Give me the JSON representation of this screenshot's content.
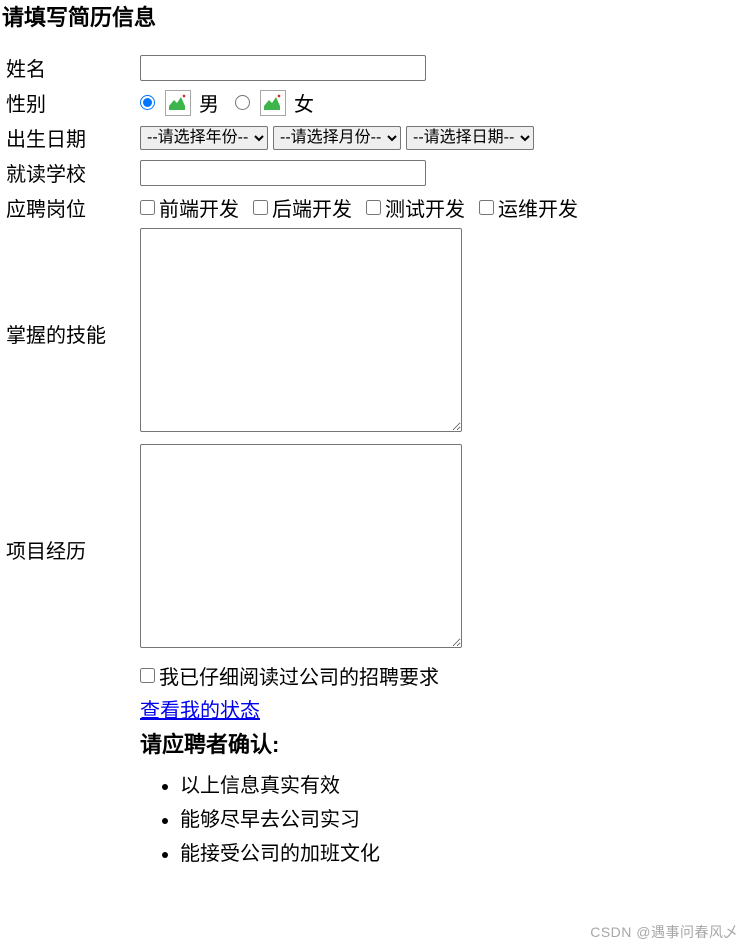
{
  "form_title": "请填写简历信息",
  "labels": {
    "name": "姓名",
    "gender": "性别",
    "birthdate": "出生日期",
    "school": "就读学校",
    "position": "应聘岗位",
    "skills": "掌握的技能",
    "projects": "项目经历"
  },
  "gender": {
    "male": "男",
    "female": "女",
    "selected": "male"
  },
  "birth_selects": {
    "year": "--请选择年份--",
    "month": "--请选择月份--",
    "day": "--请选择日期--"
  },
  "positions": [
    "前端开发",
    "后端开发",
    "测试开发",
    "运维开发"
  ],
  "agree_text": "我已仔细阅读过公司的招聘要求",
  "status_link_text": "查看我的状态",
  "confirm_title": "请应聘者确认:",
  "confirm_items": [
    "以上信息真实有效",
    "能够尽早去公司实习",
    "能接受公司的加班文化"
  ],
  "watermark": "CSDN @遇事问春风乄"
}
